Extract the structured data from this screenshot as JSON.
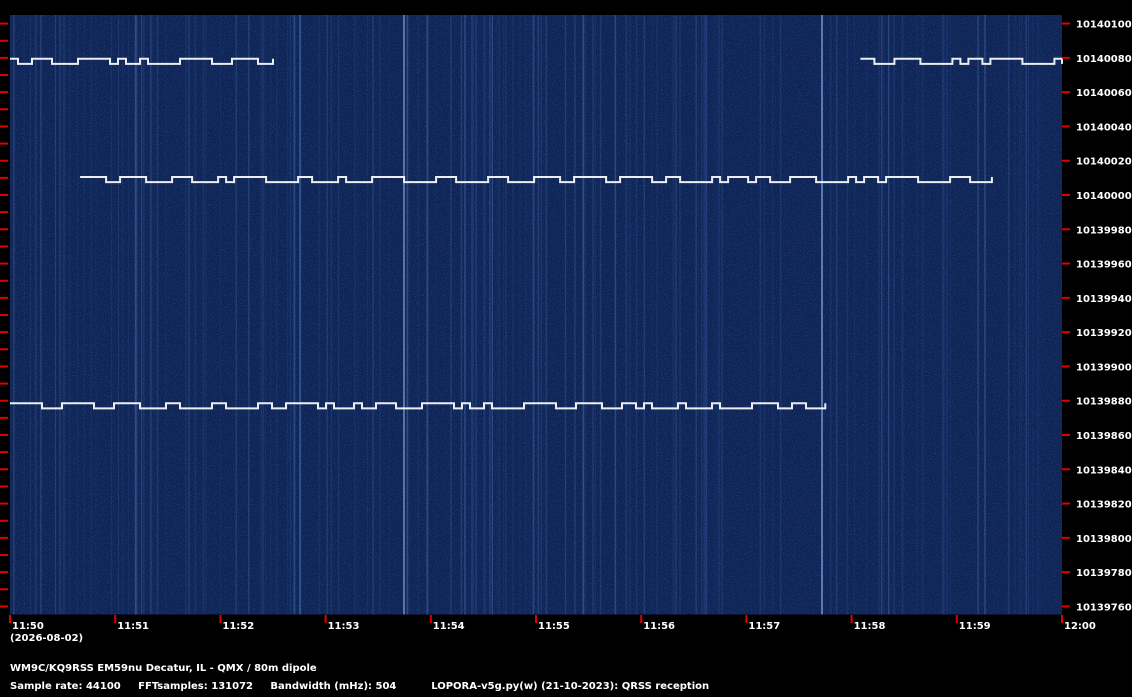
{
  "chart_data": {
    "type": "heatmap",
    "subtype": "waterfall spectrogram",
    "x_ticks": [
      "11:50",
      "11:51",
      "11:52",
      "11:53",
      "11:54",
      "11:55",
      "11:56",
      "11:57",
      "11:58",
      "11:59",
      "12:00"
    ],
    "x_date": "(2026-08-02)",
    "y_ticks": [
      10140100,
      10140080,
      10140060,
      10140040,
      10140020,
      10140000,
      10139980,
      10139960,
      10139940,
      10139920,
      10139900,
      10139880,
      10139860,
      10139840,
      10139820,
      10139800,
      10139780,
      10139760
    ],
    "ylim": [
      10139755,
      10140105
    ],
    "background_color": "#0e2456",
    "signal_color": "#ffffff",
    "tick_color": "#e00000",
    "signals": [
      {
        "freq_hz": 10140009,
        "t_start": "11:50:40",
        "t_end": "11:59:20",
        "shift_hz": 3
      },
      {
        "freq_hz": 10139877,
        "t_start": "11:50:00",
        "t_end": "11:57:45",
        "shift_hz": 3
      },
      {
        "freq_hz": 10140078,
        "t_start": "11:50:00",
        "t_end": "11:52:30",
        "shift_hz": 3
      },
      {
        "freq_hz": 10140078,
        "t_start": "11:58:05",
        "t_end": "12:00:00",
        "shift_hz": 3
      }
    ]
  },
  "footer": {
    "station": "WM9C/KQ9RSS EM59nu Decatur, IL - QMX / 80m dipole",
    "sample_rate": "Sample rate: 44100",
    "fft_samples": "FFTsamples: 131072",
    "bandwidth": "Bandwidth (mHz): 504",
    "software": "LOPORA-v5g.py(w) (21-10-2023): QRSS reception"
  }
}
